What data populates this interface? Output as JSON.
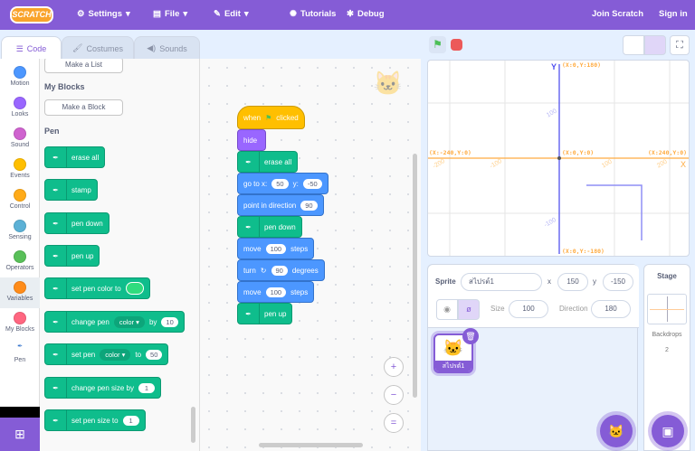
{
  "menu": {
    "logo": "SCRATCH",
    "settings": "Settings",
    "file": "File",
    "edit": "Edit",
    "tutorials": "Tutorials",
    "debug": "Debug",
    "join": "Join Scratch",
    "signin": "Sign in"
  },
  "tabs": {
    "code": "Code",
    "costumes": "Costumes",
    "sounds": "Sounds"
  },
  "categories": [
    {
      "label": "Motion",
      "color": "#4c97ff"
    },
    {
      "label": "Looks",
      "color": "#9966ff"
    },
    {
      "label": "Sound",
      "color": "#cf63cf"
    },
    {
      "label": "Events",
      "color": "#ffbf00"
    },
    {
      "label": "Control",
      "color": "#ffab19"
    },
    {
      "label": "Sensing",
      "color": "#5cb1d6"
    },
    {
      "label": "Operators",
      "color": "#59c059"
    },
    {
      "label": "Variables",
      "color": "#ff8c1a"
    },
    {
      "label": "My Blocks",
      "color": "#ff6680"
    },
    {
      "label": "Pen",
      "color": "#0fbd8c"
    }
  ],
  "palette": {
    "make_list": "Make a List",
    "my_blocks": "My Blocks",
    "make_block": "Make a Block",
    "pen_heading": "Pen",
    "blocks": {
      "erase_all": "erase all",
      "stamp": "stamp",
      "pen_down": "pen down",
      "pen_up": "pen up",
      "set_color": "set pen color to",
      "change_pen": "change pen",
      "color": "color",
      "by": "by",
      "change_val": "10",
      "set_pen": "set pen",
      "to": "to",
      "set_val": "50",
      "change_size": "change pen size by",
      "change_size_val": "1",
      "set_size": "set pen size to",
      "set_size_val": "1"
    }
  },
  "script": {
    "when": "when",
    "clicked": "clicked",
    "hide": "hide",
    "erase_all": "erase all",
    "goto": "go to x:",
    "gx": "50",
    "y": "y:",
    "gy": "-50",
    "point": "point in direction",
    "dir": "90",
    "pen_down": "pen down",
    "move": "move",
    "steps": "steps",
    "move1": "100",
    "turn": "turn",
    "turn_val": "90",
    "degrees": "degrees",
    "move2": "100",
    "pen_up": "pen up"
  },
  "stage": {
    "y_axis": "Y",
    "x_axis": "X",
    "top": "(X:0,Y:180)",
    "bottom": "(X:0,Y:-180)",
    "left": "(X:-240,Y:0)",
    "right": "(X:240,Y:0)",
    "origin": "(X:0,Y:0)",
    "ticks_x": [
      "-200",
      "-100",
      "100",
      "200"
    ],
    "ticks_y": [
      "100",
      "-100"
    ]
  },
  "sprite": {
    "label": "Sprite",
    "name": "สไปรต์1",
    "x_label": "x",
    "x": "150",
    "y_label": "y",
    "y": "-150",
    "size_label": "Size",
    "size": "100",
    "direction_label": "Direction",
    "direction": "180",
    "thumb_name": "สไปรต์1"
  },
  "stage_pane": {
    "title": "Stage",
    "backdrops_label": "Backdrops",
    "backdrops": "2"
  }
}
